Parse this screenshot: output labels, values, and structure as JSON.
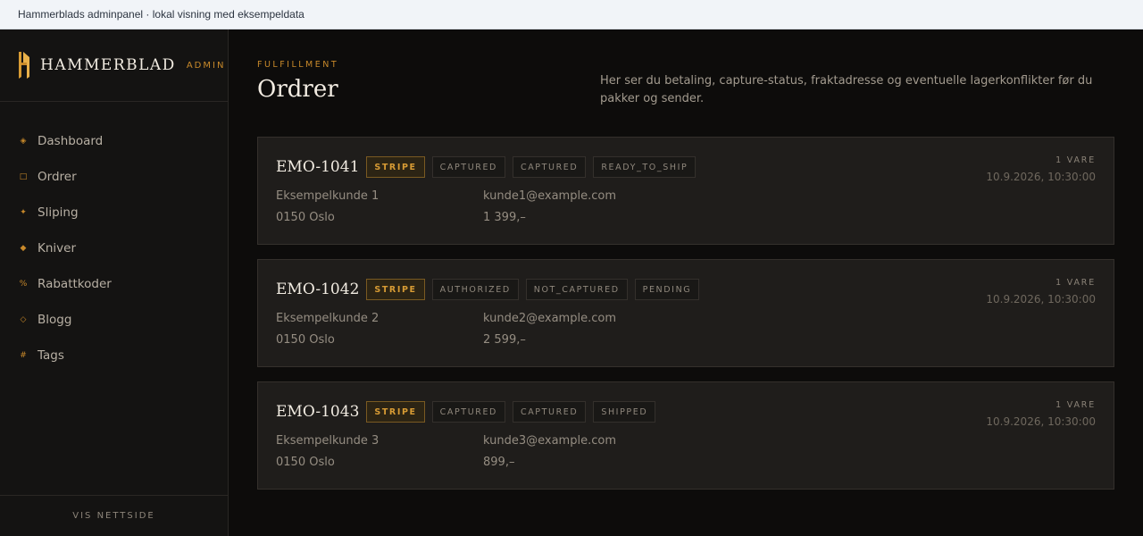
{
  "topbar": {
    "text": "Hammerblads adminpanel · lokal visning med eksempeldata"
  },
  "brand": {
    "name": "HAMMERBLAD",
    "tag": "ADMIN"
  },
  "nav": [
    {
      "icon": "◈",
      "label": "Dashboard"
    },
    {
      "icon": "□",
      "label": "Ordrer"
    },
    {
      "icon": "✦",
      "label": "Sliping"
    },
    {
      "icon": "◆",
      "label": "Kniver"
    },
    {
      "icon": "%",
      "label": "Rabattkoder"
    },
    {
      "icon": "◇",
      "label": "Blogg"
    },
    {
      "icon": "#",
      "label": "Tags"
    }
  ],
  "sidebar_footer": "VIS NETTSIDE",
  "header": {
    "eyebrow": "FULFILLMENT",
    "title": "Ordrer",
    "description": "Her ser du betaling, capture-status, fraktadresse og eventuelle lagerkonflikter før du pakker og sender."
  },
  "orders": [
    {
      "id": "EMO-1041",
      "tags": [
        "STRIPE",
        "CAPTURED",
        "CAPTURED",
        "READY_TO_SHIP"
      ],
      "customer": "Eksempelkunde 1",
      "email": "kunde1@example.com",
      "city": "0150 Oslo",
      "total": "1 399,–",
      "items": "1 VARE",
      "date": "10.9.2026, 10:30:00"
    },
    {
      "id": "EMO-1042",
      "tags": [
        "STRIPE",
        "AUTHORIZED",
        "NOT_CAPTURED",
        "PENDING"
      ],
      "customer": "Eksempelkunde 2",
      "email": "kunde2@example.com",
      "city": "0150 Oslo",
      "total": "2 599,–",
      "items": "1 VARE",
      "date": "10.9.2026, 10:30:00"
    },
    {
      "id": "EMO-1043",
      "tags": [
        "STRIPE",
        "CAPTURED",
        "CAPTURED",
        "SHIPPED"
      ],
      "customer": "Eksempelkunde 3",
      "email": "kunde3@example.com",
      "city": "0150 Oslo",
      "total": "899,–",
      "items": "1 VARE",
      "date": "10.9.2026, 10:30:00"
    }
  ],
  "colors": {
    "accent": "#c8892a",
    "background": "#0d0c0b",
    "card": "#1f1d1b"
  }
}
